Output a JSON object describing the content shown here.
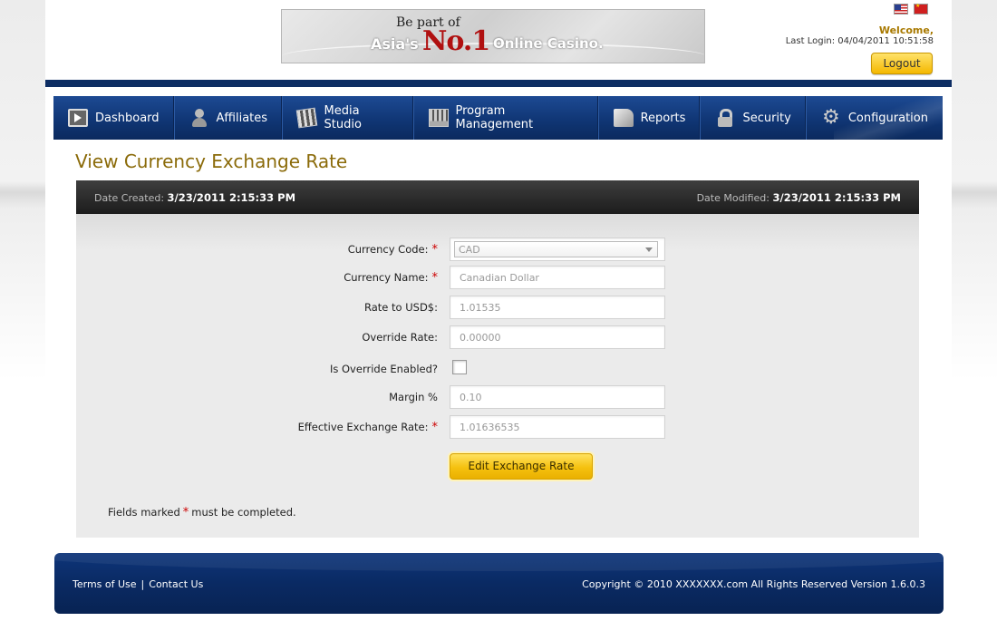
{
  "header": {
    "banner": {
      "line1": "Be part of",
      "asia": "Asia's",
      "no1": "No.1",
      "rest": "Online Casino."
    },
    "welcome": "Welcome,",
    "last_login": "Last Login: 04/04/2011 10:51:58",
    "logout_label": "Logout",
    "flags": [
      "us-flag-icon",
      "china-flag-icon"
    ]
  },
  "nav": {
    "items": [
      {
        "label": "Dashboard",
        "icon": "dashboard-icon"
      },
      {
        "label": "Affiliates",
        "icon": "affiliates-icon"
      },
      {
        "label": "Media Studio",
        "icon": "clapperboard-icon"
      },
      {
        "label": "Program Management",
        "icon": "program-chart-icon"
      },
      {
        "label": "Reports",
        "icon": "reports-icon"
      },
      {
        "label": "Security",
        "icon": "lock-icon"
      },
      {
        "label": "Configuration",
        "icon": "gear-icon"
      }
    ]
  },
  "page_title": "View Currency Exchange Rate",
  "panel": {
    "date_created_label": "Date Created:",
    "date_created": "3/23/2011 2:15:33 PM",
    "date_modified_label": "Date Modified:",
    "date_modified": "3/23/2011 2:15:33 PM"
  },
  "form": {
    "currency_code": {
      "label": "Currency Code:",
      "value": "CAD",
      "required": "*"
    },
    "currency_name": {
      "label": "Currency Name:",
      "value": "Canadian Dollar",
      "required": "*"
    },
    "rate_to_usd": {
      "label": "Rate to USD$:",
      "value": "1.01535"
    },
    "override_rate": {
      "label": "Override Rate:",
      "value": "0.00000"
    },
    "override_enabled": {
      "label": "Is Override Enabled?"
    },
    "margin": {
      "label": "Margin %",
      "value": "0.10"
    },
    "effective_rate": {
      "label": "Effective Exchange Rate:",
      "value": "1.01636535",
      "required": "*"
    },
    "edit_button": "Edit Exchange Rate",
    "note_before": "Fields marked",
    "note_star": "*",
    "note_after": "must be completed."
  },
  "footer": {
    "terms": "Terms of Use",
    "separator": "|",
    "contact": "Contact Us",
    "copyright": "Copyright © 2010 XXXXXXX.com All Rights Reserved  Version 1.6.0.3"
  }
}
